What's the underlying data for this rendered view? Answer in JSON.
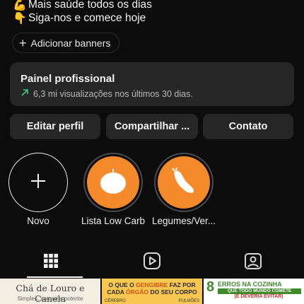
{
  "bio": {
    "lines": [
      {
        "emoji": "💪",
        "text": "Mais saúde todos os dias"
      },
      {
        "emoji": "👇",
        "text": "Siga-nos e comece hoje"
      }
    ]
  },
  "add_banners": {
    "label": "Adicionar banners"
  },
  "pro_panel": {
    "title": "Painel profissional",
    "stats": "6,3 mi visualizações nos últimos 30 dias."
  },
  "buttons": {
    "edit": "Editar perfil",
    "share": "Compartilhar ...",
    "contact": "Contato"
  },
  "highlights": [
    {
      "label": "Novo",
      "icon": "plus-icon"
    },
    {
      "label": "Lista Low Carb",
      "icon": "tomato-icon"
    },
    {
      "label": "Legumes/Ver...",
      "icon": "zucchini-icon"
    }
  ],
  "tabs": [
    {
      "name": "grid",
      "icon": "grid-icon",
      "active": true
    },
    {
      "name": "reels",
      "icon": "reels-icon",
      "active": false
    },
    {
      "name": "tagged",
      "icon": "tagged-icon",
      "active": false
    }
  ],
  "posts": [
    {
      "caption": "Chá de Louro e Canela",
      "sub": "Simples, natural e potente"
    },
    {
      "caption_a": "O QUE O ",
      "caption_hl": "GENGIBRE",
      "caption_b": " FAZ POR",
      "caption2_a": "CADA ",
      "caption2_hl": "ÓRGÃO",
      "caption2_b": " DO SEU CORPO",
      "tiny_left": "CÉREBRO",
      "tiny_right": "PULMÕES"
    },
    {
      "number": "8",
      "caption": "ERROS NA COZINHA",
      "band": "QUE TODO MUNDO COMETE",
      "warning": "(E DEVERIA EVITAR)"
    }
  ],
  "colors": {
    "background": "#0c0c0c",
    "panel": "#262626",
    "accent_orange": "#f58a2a",
    "stats_arrow": "#39c77b"
  }
}
